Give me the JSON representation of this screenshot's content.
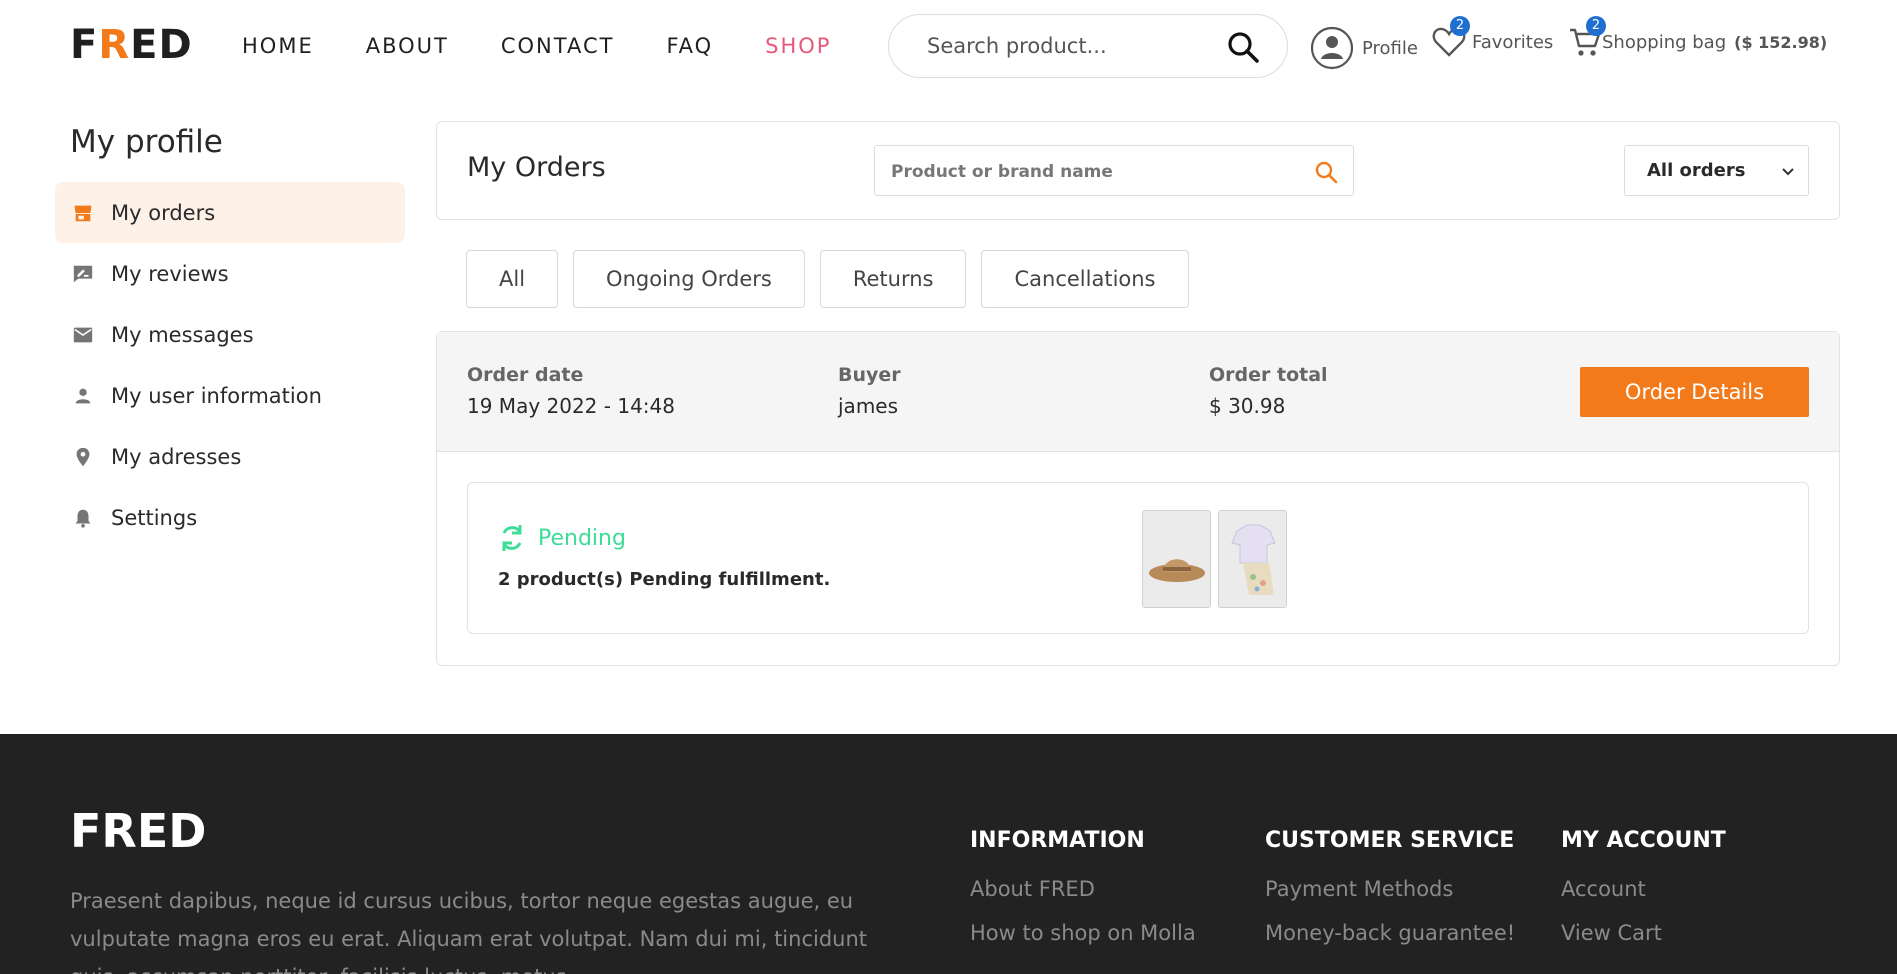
{
  "header": {
    "logo_start": "F",
    "logo_accent": "R",
    "logo_end": "ED",
    "nav": [
      "HOME",
      "ABOUT",
      "CONTACT",
      "FAQ",
      "SHOP"
    ],
    "search_placeholder": "Search product...",
    "profile_label": "Profile",
    "favorites_label": "Favorites",
    "favorites_count": "2",
    "bag_label": "Shopping bag",
    "bag_count": "2",
    "bag_total": "($ 152.98)"
  },
  "sidebar": {
    "title": "My profile",
    "items": [
      {
        "label": "My orders",
        "icon": "store-icon",
        "active": true
      },
      {
        "label": "My reviews",
        "icon": "rate-review-icon"
      },
      {
        "label": "My messages",
        "icon": "mail-icon"
      },
      {
        "label": "My user information",
        "icon": "person-icon"
      },
      {
        "label": "My adresses",
        "icon": "location-pin-icon"
      },
      {
        "label": "Settings",
        "icon": "bell-icon"
      }
    ]
  },
  "orders": {
    "title": "My Orders",
    "search_placeholder": "Product or brand name",
    "filter_value": "All orders",
    "tabs": [
      "All",
      "Ongoing Orders",
      "Returns",
      "Cancellations"
    ]
  },
  "order": {
    "date_label": "Order date",
    "date_value": "19 May 2022 - 14:48",
    "buyer_label": "Buyer",
    "buyer_value": "james",
    "total_label": "Order total",
    "total_value": "$ 30.98",
    "details_button": "Order Details",
    "status": "Pending",
    "status_text": "2 product(s) Pending fulfillment.",
    "products": [
      "hat-product-image",
      "outfit-product-image"
    ]
  },
  "footer": {
    "logo": "FRED",
    "description": "Praesent dapibus, neque id cursus ucibus, tortor neque egestas augue, eu vulputate magna eros eu erat. Aliquam erat volutpat. Nam dui mi, tincidunt quis, accumsan porttitor, facilisis luctus, metus.",
    "columns": [
      {
        "title": "INFORMATION",
        "links": [
          "About FRED",
          "How to shop on Molla"
        ]
      },
      {
        "title": "CUSTOMER SERVICE",
        "links": [
          "Payment Methods",
          "Money-back guarantee!"
        ]
      },
      {
        "title": "MY ACCOUNT",
        "links": [
          "Account",
          "View Cart"
        ]
      }
    ]
  },
  "colors": {
    "accent": "#f27a1a",
    "shop_link": "#e8577a",
    "badge": "#1e6fd0",
    "pending": "#3ddc97",
    "footer_bg": "#222222",
    "active_item_bg": "#fef1e8"
  }
}
